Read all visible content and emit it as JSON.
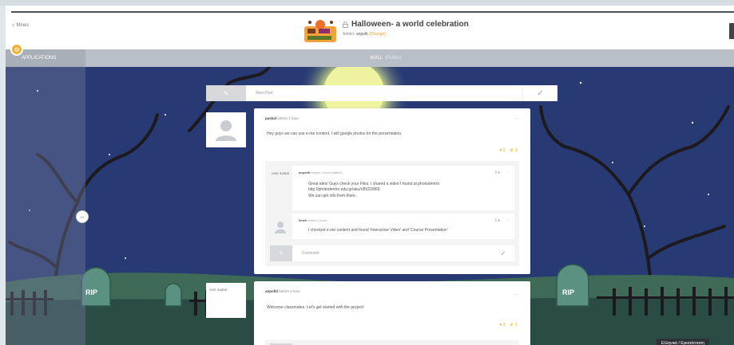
{
  "header": {
    "back_label": "Mines",
    "title": "Halloween- a world celebration",
    "admin_prefix": "Admin:",
    "admin_user": "anpolit",
    "admin_change": "(Change)"
  },
  "subbar": {
    "applications_label": "APPLICATIONS",
    "wall_label": "WALL",
    "wall_visibility": "(Public)"
  },
  "new_post": {
    "placeholder": "New Post"
  },
  "posts": [
    {
      "author": "paskal",
      "time": "before 1 hour",
      "text": "Hey guys we can use e-me content. I will google photos for the presentation.",
      "likes": "2",
      "bolts": "1",
      "comments": [
        {
          "avatar_label": "user avatar",
          "author": "anpoliti",
          "time": "before 1 hour (edited)",
          "text_lines": [
            "Great idea! Guys check your Files, I shared a video I found at photodentro",
            "http://photodentro.edu.gr/aku/r/8522/866",
            "We can get info from there."
          ],
          "meta": "0 ♥"
        },
        {
          "author": "limeli",
          "time": "before 1 hour",
          "text": "I checked e-me content and found 'Interactive Video' and 'Course Presentation'",
          "meta": "0 ♥"
        }
      ],
      "comment_placeholder": "Comment"
    },
    {
      "avatar_label": "user avatar",
      "author": "anpoliti",
      "time": "before 1 hour",
      "text": "Welcome classmates. Let's get started with the project!",
      "likes": "3",
      "bolts": "1"
    }
  ],
  "language_badge": "Ελληνικά / Εγκατάσταση",
  "icons": {
    "back": "chevron-left-icon",
    "lock": "lock-icon",
    "gear": "gear-icon",
    "edit": "edit-icon",
    "send": "check-icon",
    "like": "like-icon",
    "bolt": "bolt-icon",
    "menu": "more-icon",
    "handle": "resize-handle-icon"
  },
  "colors": {
    "scene": "#283a73",
    "accent": "#f1b233",
    "subbar": "#b9bfc6"
  }
}
